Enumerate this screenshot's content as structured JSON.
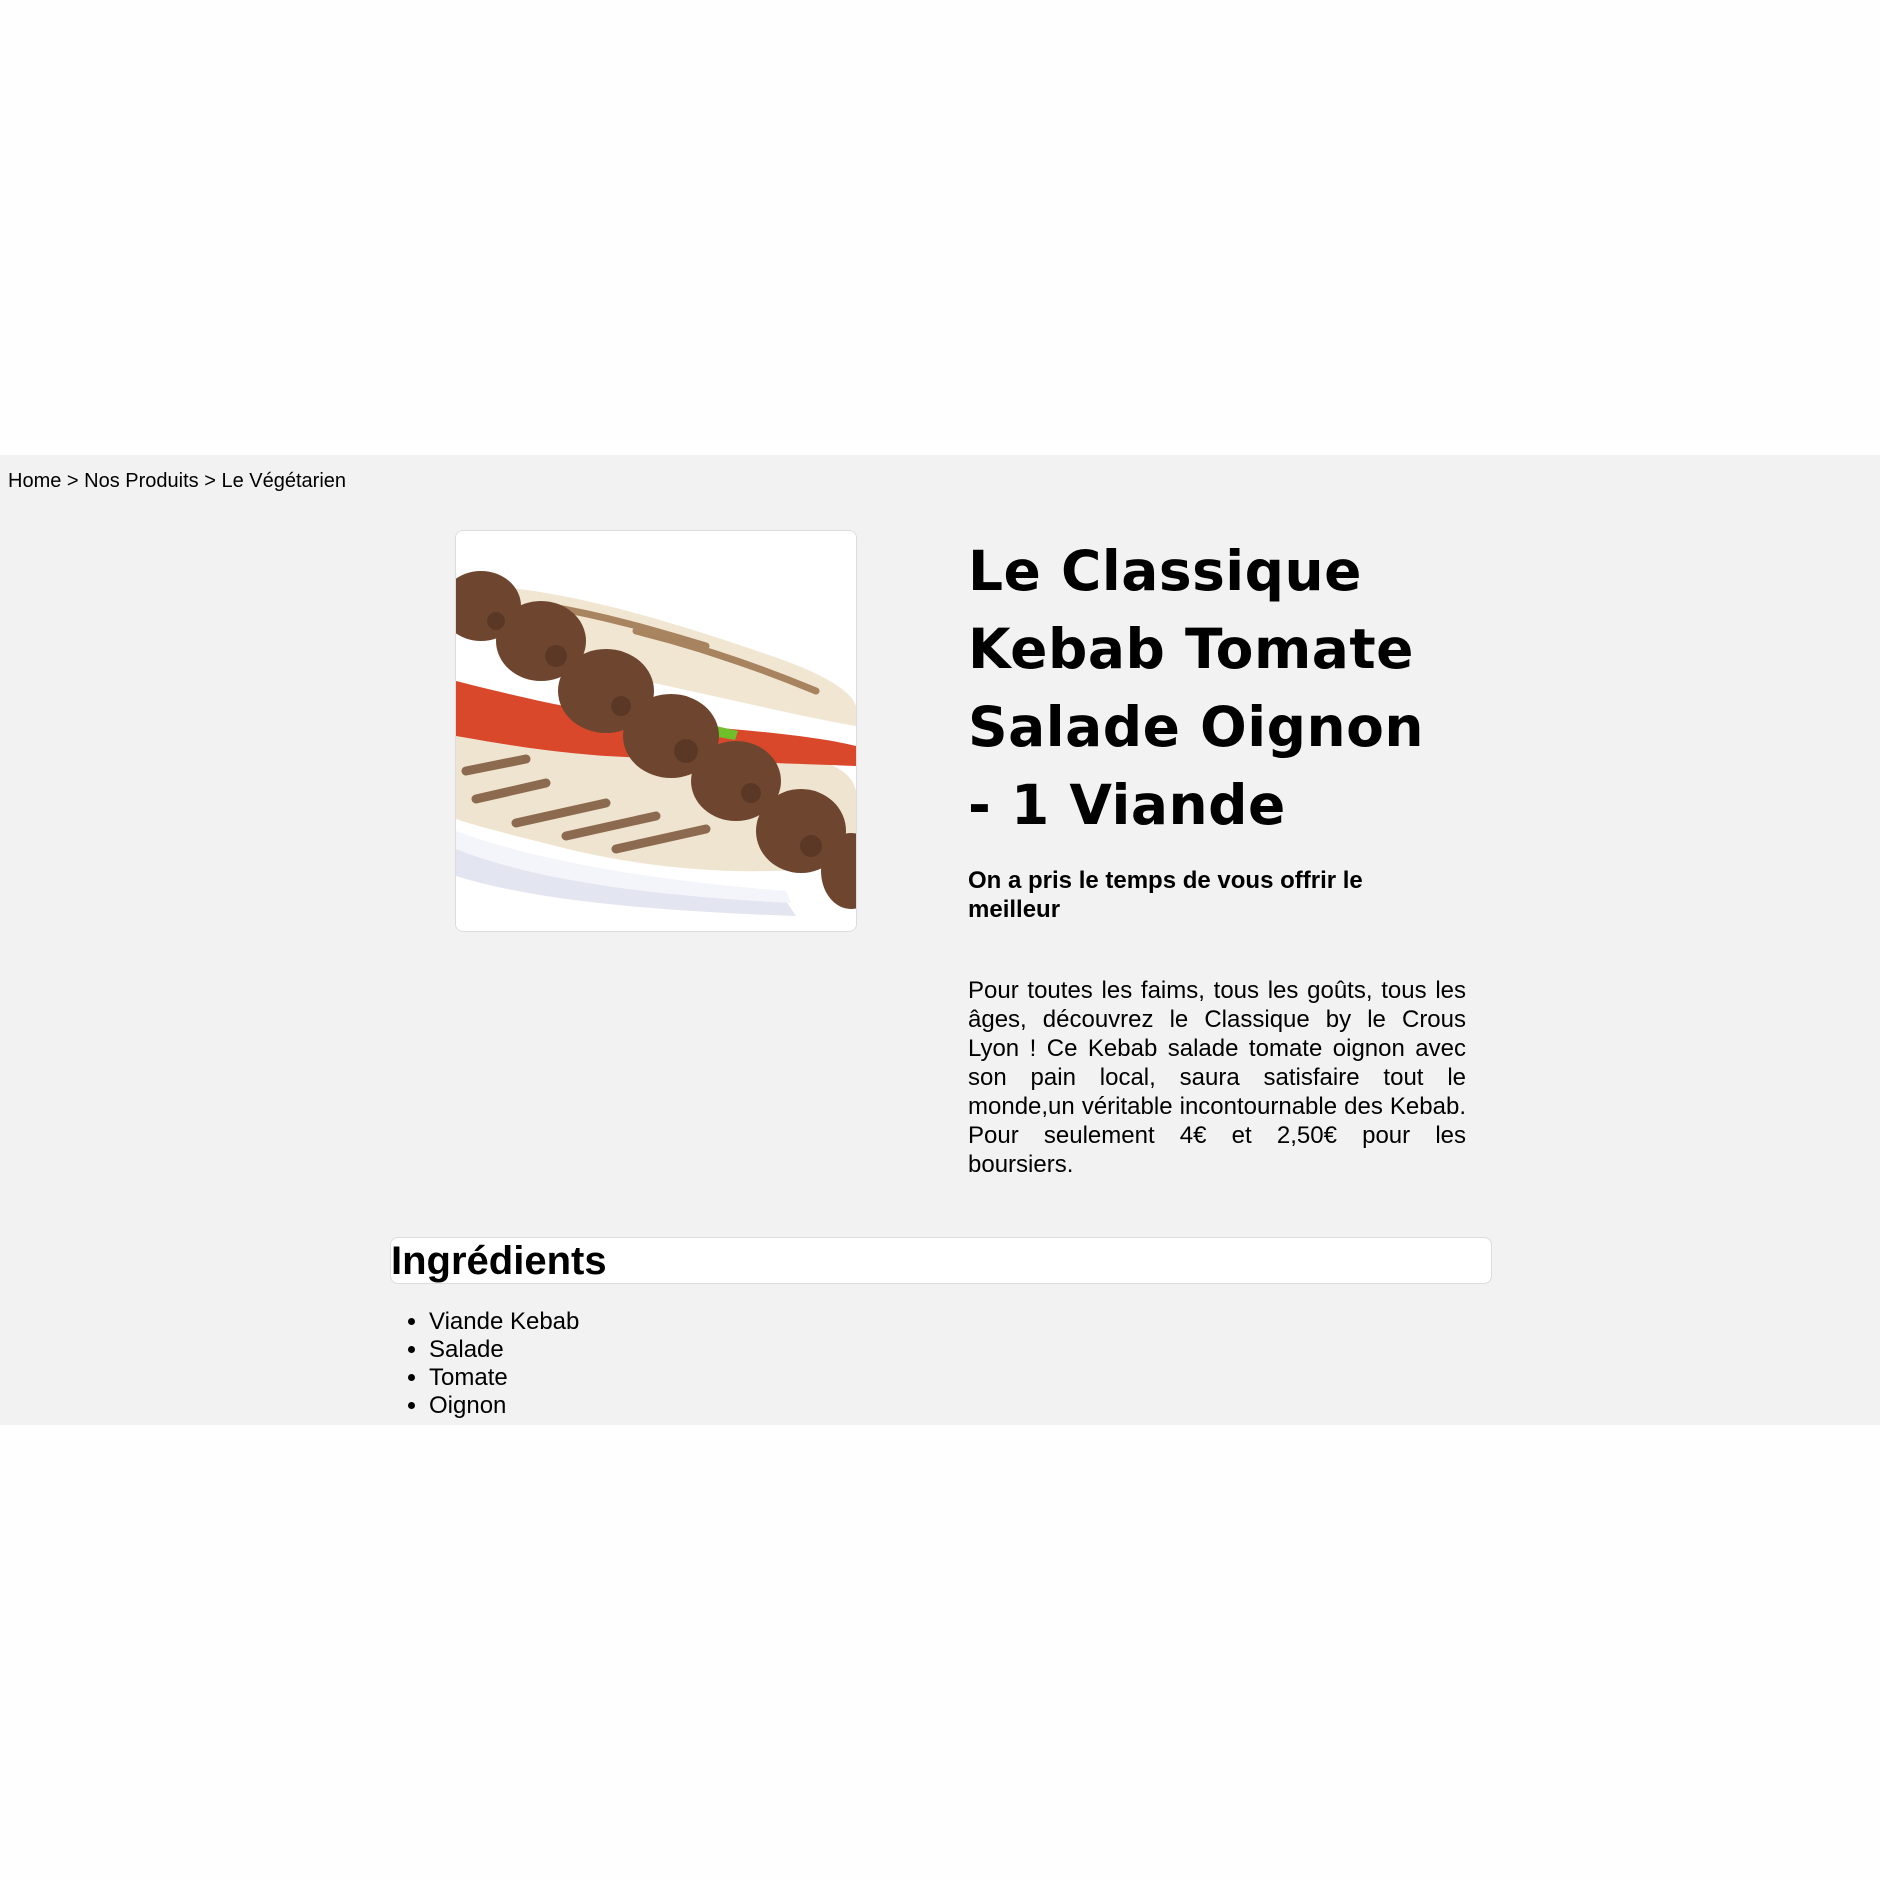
{
  "breadcrumb": {
    "items": [
      "Home",
      "Nos Produits",
      "Le Végétarien"
    ],
    "separator": ">"
  },
  "product": {
    "image_icon": "kebab-sandwich-image",
    "title": "Le Classique Kebab Tomate Salade Oignon - 1 Viande",
    "tagline": "On a pris le temps de vous offrir le meilleur",
    "description": "Pour toutes les faims, tous les goûts, tous les âges, découvrez le Classique by le Crous Lyon ! Ce Kebab salade tomate oignon avec son pain local, saura satisfaire tout le monde,un véritable incontournable des Kebab. Pour seulement 4€ et 2,50€ pour les boursiers."
  },
  "ingredients": {
    "title": "Ingrédients",
    "items": [
      "Viande Kebab",
      "Salade",
      "Tomate",
      "Oignon"
    ]
  },
  "colors": {
    "background": "#fefefe",
    "band": "#f2f2f2",
    "card": "#ffffff",
    "border": "#dcdcdc"
  }
}
